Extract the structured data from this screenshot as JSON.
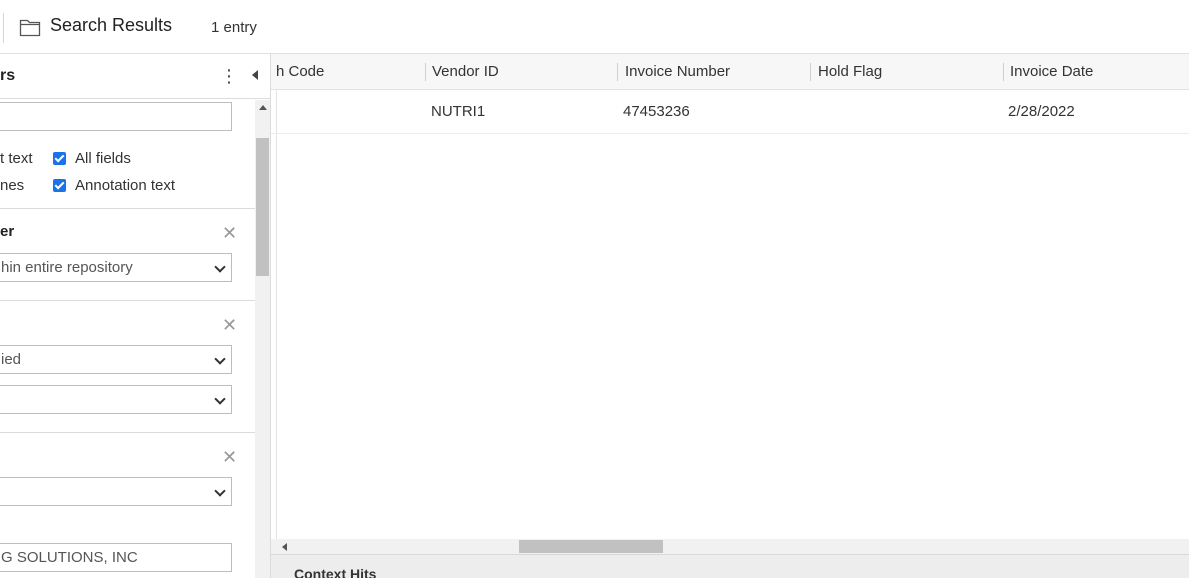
{
  "header": {
    "title": "Search Results",
    "count": "1 entry",
    "icon": "folder-icon"
  },
  "filters": {
    "panel_title": "rs",
    "search_value": "",
    "checkboxes": [
      {
        "label": "t text",
        "checked": null
      },
      {
        "label": "All fields",
        "checked": true
      },
      {
        "label": "nes",
        "checked": null
      },
      {
        "label": "Annotation text",
        "checked": true
      }
    ],
    "sections": [
      {
        "title": "er",
        "dropdown": "hin entire repository"
      },
      {
        "title": "",
        "dropdown1": "ied",
        "dropdown2": ""
      },
      {
        "title": "",
        "dropdown": "",
        "text_value": "G SOLUTIONS, INC"
      }
    ]
  },
  "grid": {
    "columns": [
      "h Code",
      "Vendor ID",
      "Invoice Number",
      "Hold Flag",
      "Invoice Date"
    ],
    "rows": [
      {
        "code": "",
        "vendor_id": "NUTRI1",
        "invoice_number": "47453236",
        "hold_flag": "",
        "invoice_date": "2/28/2022"
      }
    ]
  },
  "context": {
    "title": "Context Hits"
  },
  "colors": {
    "checkbox": "#1a73e8",
    "header_bg": "#f7f7f7",
    "scroll_thumb": "#c1c1c1"
  }
}
